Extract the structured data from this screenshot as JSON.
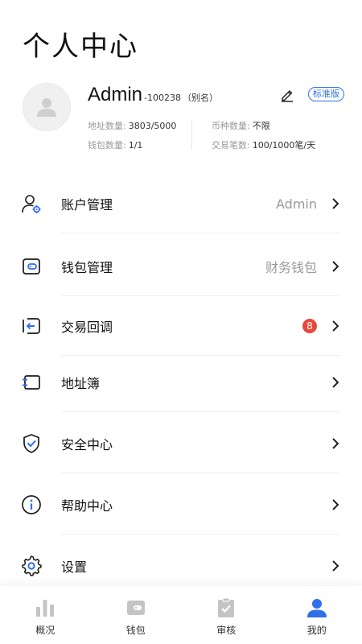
{
  "page": {
    "title": "个人中心"
  },
  "profile": {
    "name": "Admin",
    "uid": "-100238",
    "alias": "（别名）",
    "edition_badge": "标准版",
    "stats": [
      {
        "key": "地址数量:",
        "value": "3803/5000"
      },
      {
        "key": "币种数量:",
        "value": "不限"
      },
      {
        "key": "钱包数量:",
        "value": "1/1"
      },
      {
        "key": "交易笔数:",
        "value": "100/1000笔/天"
      }
    ]
  },
  "menu": [
    {
      "label": "账户管理",
      "value": "Admin",
      "icon": "user-gear-icon"
    },
    {
      "label": "钱包管理",
      "value": "财务钱包",
      "icon": "wallet-icon"
    },
    {
      "label": "交易回调",
      "count": "8",
      "icon": "callback-arrow-icon"
    },
    {
      "label": "地址簿",
      "icon": "address-book-icon"
    },
    {
      "label": "安全中心",
      "icon": "shield-check-icon"
    },
    {
      "label": "帮助中心",
      "icon": "info-circle-icon"
    },
    {
      "label": "设置",
      "icon": "gear-icon"
    }
  ],
  "tabs": [
    {
      "label": "概况",
      "icon": "bar-chart-icon"
    },
    {
      "label": "钱包",
      "icon": "wallet-icon"
    },
    {
      "label": "审核",
      "icon": "clipboard-check-icon"
    },
    {
      "label": "我的",
      "icon": "person-icon",
      "active": true
    }
  ],
  "colors": {
    "accent": "#2f6fe8",
    "badge_red": "#e8483c",
    "inactive_icon": "#c4c4c4"
  }
}
